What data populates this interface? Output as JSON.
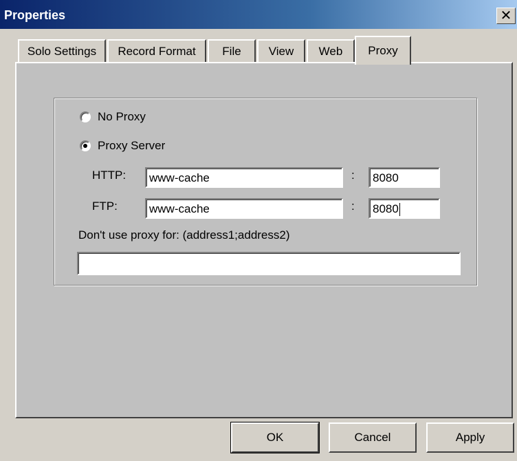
{
  "window": {
    "title": "Properties",
    "close_glyph": "✕"
  },
  "tabs": [
    {
      "label": "Solo Settings"
    },
    {
      "label": "Record Format"
    },
    {
      "label": "File"
    },
    {
      "label": "View"
    },
    {
      "label": "Web"
    },
    {
      "label": "Proxy",
      "active": true
    }
  ],
  "proxy": {
    "no_proxy_label": "No Proxy",
    "proxy_server_label": "Proxy Server",
    "selected": "Proxy Server",
    "http_label": "HTTP:",
    "http_host": "www-cache",
    "http_port": "8080",
    "ftp_label": "FTP:",
    "ftp_host": "www-cache",
    "ftp_port": "8080",
    "separator": ":",
    "exclude_label": "Don't use proxy for: (address1;address2)",
    "exclude_value": ""
  },
  "buttons": {
    "ok": "OK",
    "cancel": "Cancel",
    "apply": "Apply"
  }
}
